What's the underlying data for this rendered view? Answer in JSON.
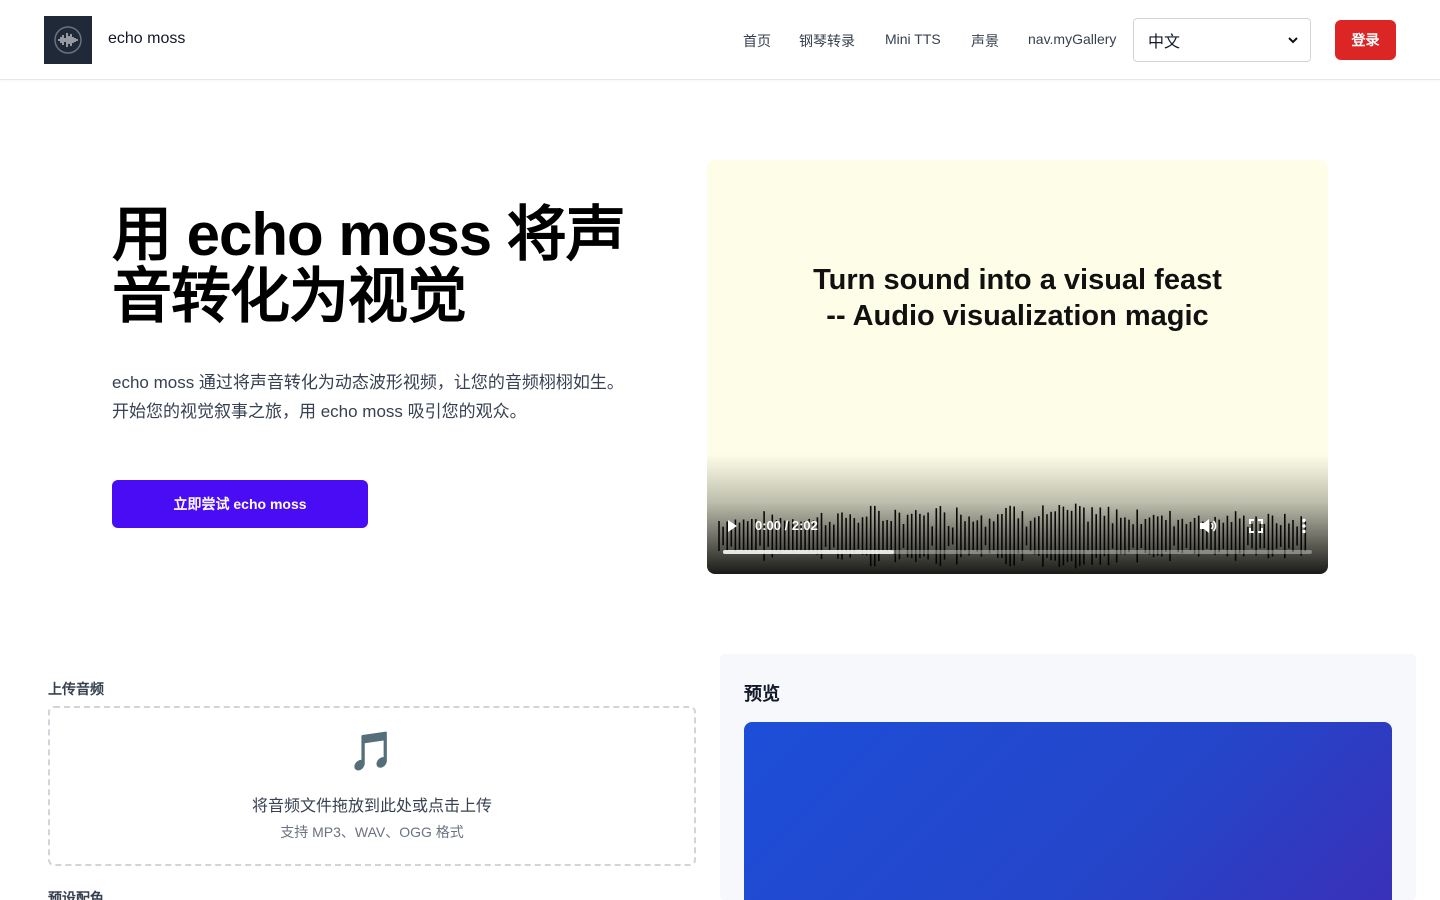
{
  "header": {
    "brand": "echo moss",
    "nav": [
      "首页",
      "钢琴转录",
      "Mini TTS",
      "声景",
      "nav.myGallery"
    ],
    "language_selected": "中文",
    "login_label": "登录"
  },
  "hero": {
    "title": "用 echo moss 将声音转化为视觉",
    "description": "echo moss 通过将声音转化为动态波形视频，让您的音频栩栩如生。开始您的视觉叙事之旅，用 echo moss 吸引您的观众。",
    "cta_label": "立即尝试 echo moss"
  },
  "video": {
    "overlay_text": "Turn sound into a visual feast\n-- Audio visualization magic",
    "time": "0:00 / 2:02",
    "buffered_fraction": 0.29
  },
  "upload": {
    "label": "上传音频",
    "dropzone_icon": "🎵",
    "dropzone_text": "将音频文件拖放到此处或点击上传",
    "dropzone_subtext": "支持 MP3、WAV、OGG 格式"
  },
  "preset": {
    "label": "预设配色"
  },
  "preview": {
    "title": "预览"
  },
  "colors": {
    "login": "#dc2626",
    "cta": "#4a0bf5",
    "video_bg": "#fefee8",
    "preview_gradient_start": "#1d4ed8"
  }
}
